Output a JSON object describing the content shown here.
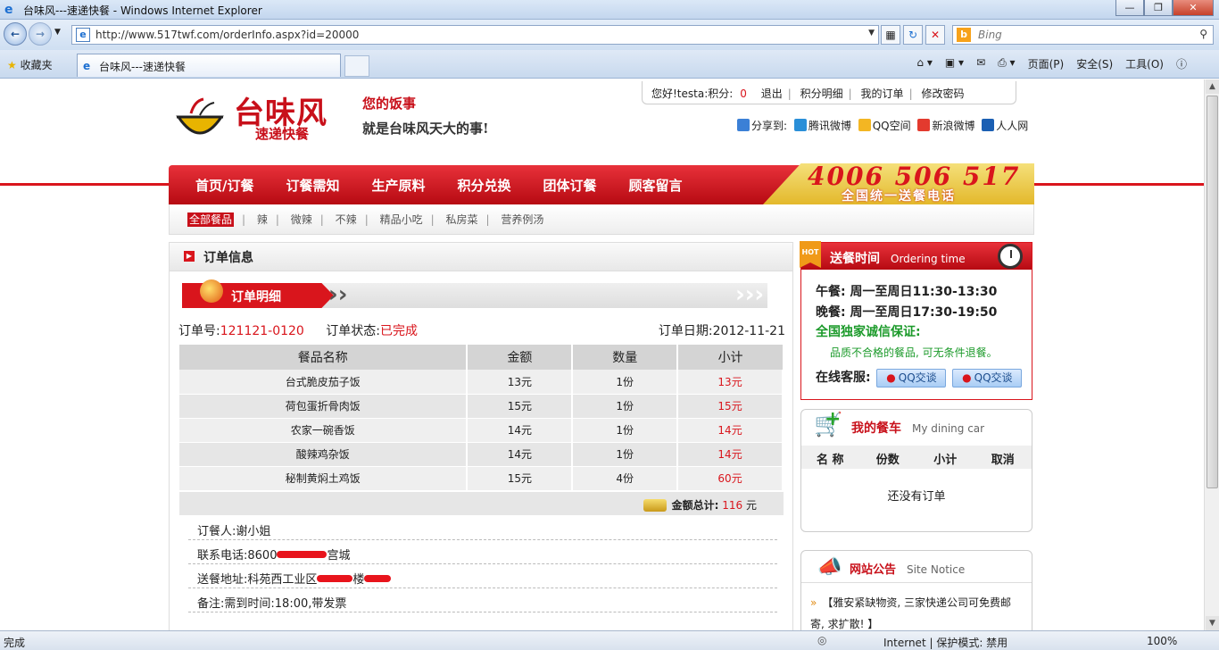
{
  "browser": {
    "window_title": "台味风---速递快餐 - Windows Internet Explorer",
    "url": "http://www.517twf.com/orderInfo.aspx?id=20000",
    "search_placeholder": "Bing",
    "favorites_label": "收藏夹",
    "tab_title": "台味风---速递快餐",
    "tools": [
      "页面(P)",
      "安全(S)",
      "工具(O)"
    ],
    "status_left": "完成",
    "status_zone": "Internet | 保护模式: 禁用",
    "status_zoom": "100%"
  },
  "site": {
    "logo_name": "台味风",
    "logo_sub": "速递快餐",
    "slogan_line1": "您的饭事",
    "slogan_line2": "就是台味风天大的事!",
    "userbar": {
      "greeting": "您好!testa:积分:",
      "points": "0",
      "links": [
        "退出",
        "积分明细",
        "我的订单",
        "修改密码"
      ]
    },
    "share": {
      "label": "分享到:",
      "targets": [
        "腾讯微博",
        "QQ空间",
        "新浪微博",
        "人人网"
      ]
    },
    "nav": [
      "首页/订餐",
      "订餐需知",
      "生产原料",
      "积分兑换",
      "团体订餐",
      "顾客留言"
    ],
    "phone_number": "4006 506 517",
    "phone_caption": "全国统一送餐电话",
    "subnav": [
      "全部餐品",
      "辣",
      "微辣",
      "不辣",
      "精品小吃",
      "私房菜",
      "营养例汤"
    ]
  },
  "order": {
    "section_title": "订单信息",
    "detail_title": "订单明细",
    "number_label": "订单号:",
    "number": "121121-0120",
    "status_label": "订单状态:",
    "status": "已完成",
    "date_label": "订单日期:",
    "date": "2012-11-21",
    "columns": [
      "餐品名称",
      "金额",
      "数量",
      "小计"
    ],
    "rows": [
      [
        "台式脆皮茄子饭",
        "13元",
        "1份",
        "13元"
      ],
      [
        "荷包蛋折骨肉饭",
        "15元",
        "1份",
        "15元"
      ],
      [
        "农家一碗香饭",
        "14元",
        "1份",
        "14元"
      ],
      [
        "酸辣鸡杂饭",
        "14元",
        "1份",
        "14元"
      ],
      [
        "秘制黄焖土鸡饭",
        "15元",
        "4份",
        "60元"
      ]
    ],
    "total_label": "金额总计:",
    "total_value": "116",
    "total_unit": "元",
    "customer_label": "订餐人:",
    "customer": "谢小姐",
    "phone_label": "联系电话:",
    "phone_visible": "8600",
    "phone_tail": "宫城",
    "address_label": "送餐地址:",
    "address_visible": "科苑西工业区",
    "address_tail": "楼",
    "note_label": "备注:",
    "note": "需到时间:18:00,带发票"
  },
  "delivery": {
    "title": "送餐时间",
    "title_en": "Ordering time",
    "lunch": "午餐: 周一至周日11:30-13:30",
    "dinner": "晚餐: 周一至周日17:30-19:50",
    "guarantee": "全国独家诚信保证:",
    "guarantee_note": "品质不合格的餐品, 可无条件退餐。",
    "service_label": "在线客服:",
    "qq_button": "QQ交谈"
  },
  "cart": {
    "title": "我的餐车",
    "title_en": "My dining car",
    "columns": [
      "名 称",
      "份数",
      "小计",
      "取消"
    ],
    "empty": "还没有订单"
  },
  "notice": {
    "title": "网站公告",
    "title_en": "Site Notice",
    "items": [
      "【雅安紧缺物资, 三家快递公司可免费邮寄, 求扩散! 】"
    ]
  }
}
